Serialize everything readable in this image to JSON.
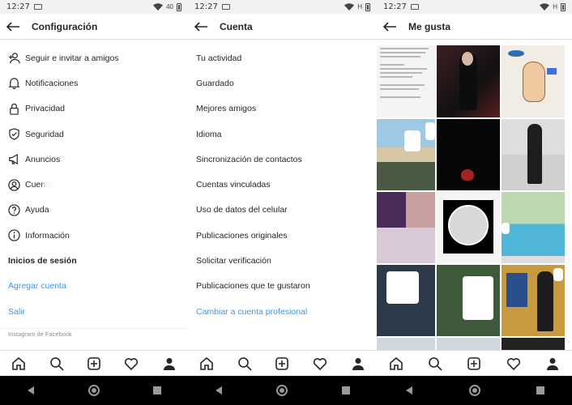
{
  "status": {
    "time": "12:27",
    "battery": "40",
    "network": "H"
  },
  "panel1": {
    "title": "Configuración",
    "items": [
      {
        "label": "Seguir e invitar a amigos",
        "icon": "add-person-icon"
      },
      {
        "label": "Notificaciones",
        "icon": "bell-icon"
      },
      {
        "label": "Privacidad",
        "icon": "lock-icon"
      },
      {
        "label": "Seguridad",
        "icon": "shield-icon"
      },
      {
        "label": "Anuncios",
        "icon": "megaphone-icon"
      },
      {
        "label": "Cuenta",
        "icon": "account-icon"
      },
      {
        "label": "Ayuda",
        "icon": "help-icon"
      },
      {
        "label": "Información",
        "icon": "info-icon"
      }
    ],
    "section": "Inicios de sesión",
    "add_account": "Agregar cuenta",
    "logout": "Salir",
    "footer": "Instagram de Facebook"
  },
  "panel2": {
    "title": "Cuenta",
    "items": [
      "Tu actividad",
      "Guardado",
      "Mejores amigos",
      "Idioma",
      "Sincronización de contactos",
      "Cuentas vinculadas",
      "Uso de datos del celular",
      "Publicaciones originales",
      "Solicitar verificación",
      "Publicaciones que te gustaron"
    ],
    "switch_link": "Cambiar a cuenta profesional"
  },
  "panel3": {
    "title": "Me gusta"
  },
  "colors": {
    "link": "#3897f0",
    "text": "#262626",
    "divider": "#dbdbdb",
    "navbar": "#000000"
  }
}
